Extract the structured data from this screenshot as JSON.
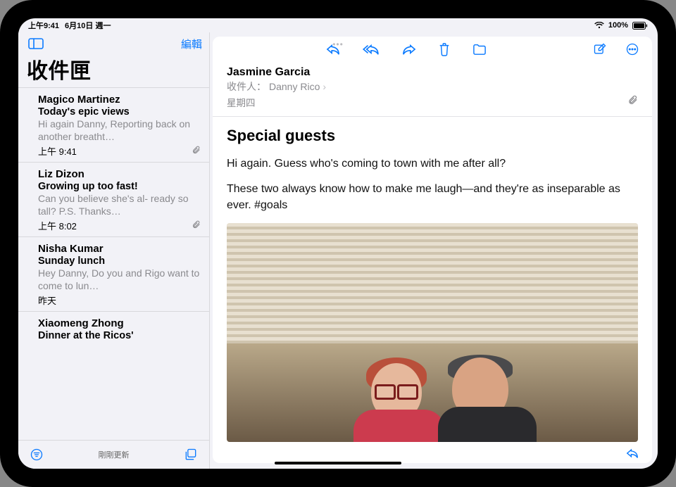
{
  "status": {
    "time": "上午9:41",
    "date": "6月10日 週一",
    "battery": "100%"
  },
  "sidebar": {
    "edit_label": "編輯",
    "title": "收件匣",
    "status_text": "剛剛更新",
    "items": [
      {
        "sender": "Magico Martinez",
        "subject": "Today's epic views",
        "preview": "Hi again Danny, Reporting back on another breatht…",
        "time": "上午 9:41",
        "has_attachment": true
      },
      {
        "sender": "Liz Dizon",
        "subject": "Growing up too fast!",
        "preview": "Can you believe she's al-\nready so tall? P.S. Thanks…",
        "time": "上午 8:02",
        "has_attachment": true
      },
      {
        "sender": "Nisha Kumar",
        "subject": "Sunday lunch",
        "preview": "Hey Danny, Do you and Rigo want to come to lun…",
        "time": "昨天",
        "has_attachment": false
      },
      {
        "sender": "Xiaomeng Zhong",
        "subject": "Dinner at the Ricos'",
        "preview": "",
        "time": "",
        "has_attachment": false
      }
    ]
  },
  "message": {
    "from": "Jasmine Garcia",
    "to_label": "收件人：",
    "to_name": "Danny Rico",
    "date": "星期四",
    "subject": "Special guests",
    "paragraphs": [
      "Hi again. Guess who's coming to town with me after all?",
      "These two always know how to make me laugh—and they're as inseparable as ever. #goals"
    ]
  }
}
